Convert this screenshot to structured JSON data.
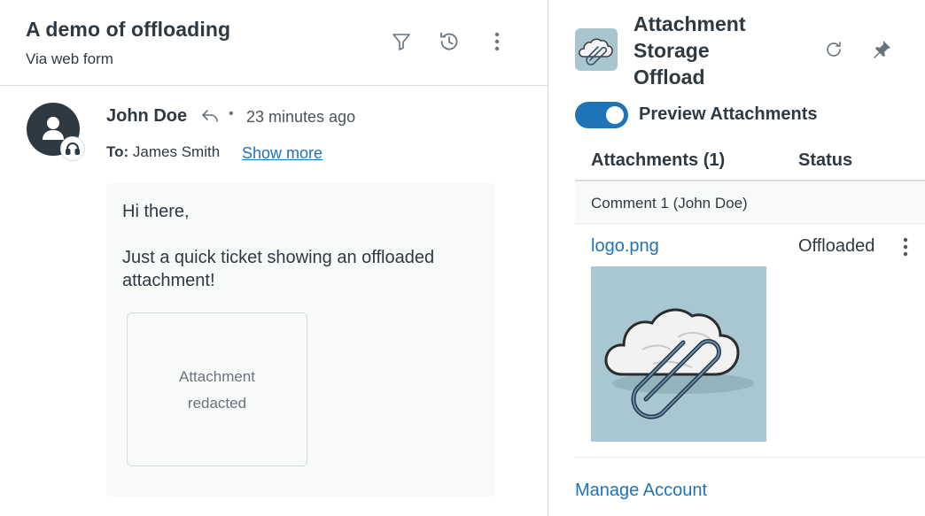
{
  "ticket": {
    "title": "A demo of offloading",
    "channel": "Via web form"
  },
  "toolbar": {
    "icons": [
      "filter-icon",
      "history-icon",
      "more-vertical-icon"
    ]
  },
  "comment": {
    "author": "John Doe",
    "time": "23 minutes ago",
    "to_label": "To:",
    "to_value": "James Smith",
    "show_more": "Show more",
    "body": [
      "Hi there,",
      "Just a quick ticket showing an offloaded",
      "attachment!"
    ],
    "redacted": [
      "Attachment",
      "redacted"
    ]
  },
  "app": {
    "title_lines": [
      "Attachment",
      "Storage",
      "Offload"
    ],
    "toggle_label": "Preview Attachments",
    "toggle_on": true,
    "accent": "#1f73b7",
    "columns": [
      "Attachments (1)",
      "Status"
    ],
    "group": "Comment 1 (John Doe)",
    "attachment": {
      "name": "logo.png",
      "status": "Offloaded"
    },
    "manage": "Manage Account"
  }
}
